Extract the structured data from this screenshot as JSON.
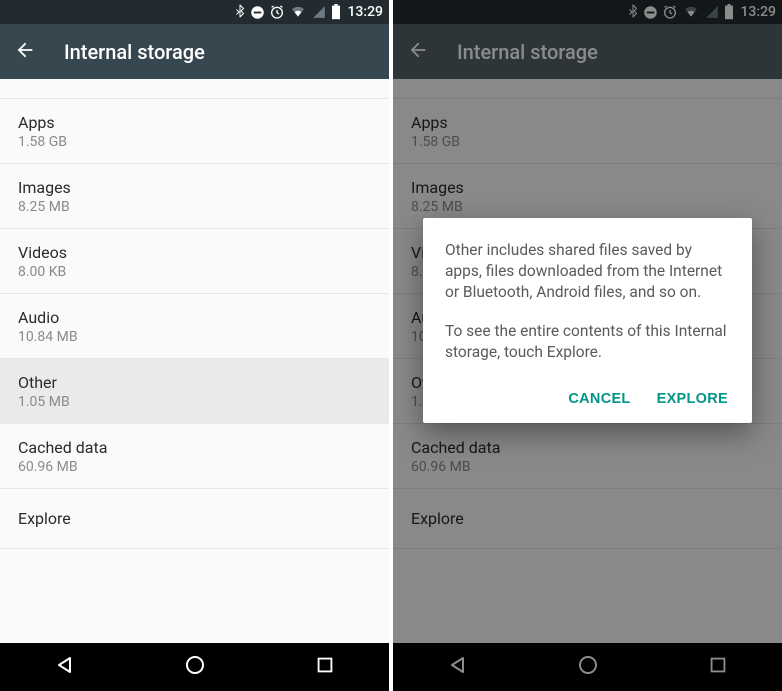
{
  "statusbar": {
    "time": "13:29"
  },
  "appbar": {
    "title": "Internal storage"
  },
  "items": [
    {
      "label": "Apps",
      "sub": "1.58 GB"
    },
    {
      "label": "Images",
      "sub": "8.25 MB"
    },
    {
      "label": "Videos",
      "sub": "8.00 KB"
    },
    {
      "label": "Audio",
      "sub": "10.84 MB"
    },
    {
      "label": "Other",
      "sub": "1.05 MB"
    },
    {
      "label": "Cached data",
      "sub": "60.96 MB"
    },
    {
      "label": "Explore",
      "sub": null
    }
  ],
  "dialog": {
    "p1": "Other includes shared files saved by apps, files downloaded from the Internet or Bluetooth, Android files, and so on.",
    "p2": "To see the entire contents of this Internal storage, touch Explore.",
    "cancel": "CANCEL",
    "explore": "EXPLORE"
  }
}
